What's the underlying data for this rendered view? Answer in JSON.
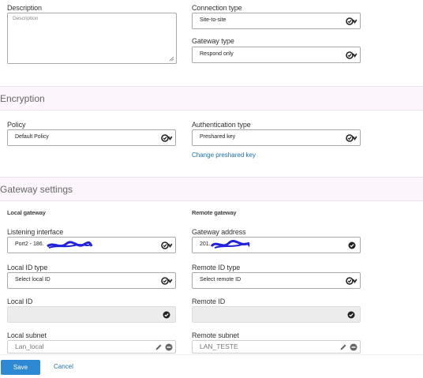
{
  "general": {
    "description_label": "Description",
    "description_placeholder": "Description",
    "connection_type_label": "Connection type",
    "connection_type_value": "Site-to-site",
    "gateway_type_label": "Gateway type",
    "gateway_type_value": "Respond only"
  },
  "encryption": {
    "heading": "Encryption",
    "policy_label": "Policy",
    "policy_value": "Default Policy",
    "auth_type_label": "Authentication type",
    "auth_type_value": "Preshared key",
    "change_key_link": "Change preshared key"
  },
  "gateway_settings": {
    "heading": "Gateway settings",
    "local": {
      "title": "Local gateway",
      "listening_interface_label": "Listening interface",
      "listening_interface_value": "Port2 - 186.",
      "local_id_type_label": "Local ID type",
      "local_id_type_value": "Select local ID",
      "local_id_label": "Local ID",
      "local_subnet_label": "Local subnet",
      "local_subnet_value": "Lan_local"
    },
    "remote": {
      "title": "Remote gateway",
      "gateway_address_label": "Gateway address",
      "gateway_address_value": "201.",
      "remote_id_type_label": "Remote ID type",
      "remote_id_type_value": "Select remote ID",
      "remote_id_label": "Remote ID",
      "remote_subnet_label": "Remote subnet",
      "remote_subnet_value": "LAN_TESTE"
    }
  },
  "footer": {
    "save_label": "Save",
    "cancel_label": "Cancel"
  },
  "colors": {
    "accent": "#2f88d4",
    "link": "#1a6fb5",
    "section_bg": "#fcf5fb",
    "redaction": "#2222dd"
  },
  "icons": [
    "chevron-check-icon",
    "ok-check-icon",
    "edit-pencil-icon",
    "remove-minus-icon",
    "resize-grip-icon"
  ]
}
